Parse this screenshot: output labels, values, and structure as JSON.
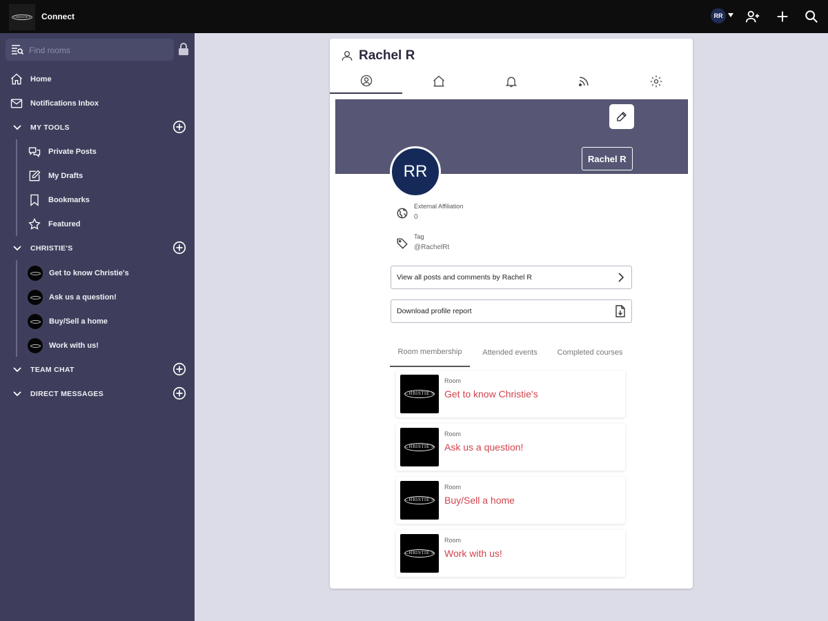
{
  "topbar": {
    "logo_text": "CHRISTIE'S",
    "app_title": "Connect",
    "avatar_initials": "RR"
  },
  "sidebar": {
    "search_placeholder": "Find rooms",
    "home": "Home",
    "notifications": "Notifications Inbox",
    "my_tools": {
      "label": "MY TOOLS",
      "items": [
        "Private Posts",
        "My Drafts",
        "Bookmarks",
        "Featured"
      ]
    },
    "christies": {
      "label": "CHRISTIE'S",
      "items": [
        "Get to know Christie's",
        "Ask us a question!",
        "Buy/Sell a home",
        "Work with us!"
      ]
    },
    "team_chat": "TEAM CHAT",
    "direct_messages": "DIRECT MESSAGES"
  },
  "profile": {
    "name": "Rachel R",
    "initials": "RR",
    "banner_name": "Rachel R",
    "external_affiliation_label": "External Affiliation",
    "external_affiliation_value": "0",
    "tag_label": "Tag",
    "tag_value": "@RachelRt",
    "view_posts_label": "View all posts and comments by Rachel R",
    "download_report_label": "Download profile report",
    "sub_tabs": [
      "Room membership",
      "Attended events",
      "Completed courses"
    ],
    "rooms": [
      {
        "type": "Room",
        "name": "Get to know Christie's"
      },
      {
        "type": "Room",
        "name": "Ask us a question!"
      },
      {
        "type": "Room",
        "name": "Buy/Sell a home"
      },
      {
        "type": "Room",
        "name": "Work with us!"
      }
    ]
  },
  "colors": {
    "sidebar_bg": "#3e3e5c",
    "banner_bg": "#575775",
    "avatar_bg": "#162a5a",
    "room_link": "#d2434c"
  }
}
